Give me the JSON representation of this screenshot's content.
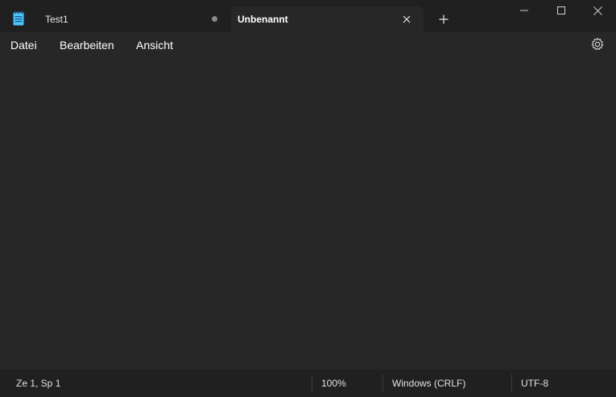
{
  "window": {
    "tabs": [
      {
        "label": "Test1",
        "active": false,
        "unsaved": true
      },
      {
        "label": "Unbenannt",
        "active": true
      }
    ],
    "icons": {
      "app": "notepad-icon",
      "close_tab": "close-icon",
      "new_tab": "plus-icon",
      "minimize": "minimize-icon",
      "maximize": "maximize-icon",
      "close_window": "close-icon",
      "settings": "gear-icon"
    }
  },
  "menubar": {
    "items": [
      "Datei",
      "Bearbeiten",
      "Ansicht"
    ]
  },
  "editor": {
    "content": ""
  },
  "statusbar": {
    "position": "Ze 1, Sp 1",
    "zoom": "100%",
    "line_ending": "Windows (CRLF)",
    "encoding": "UTF-8"
  },
  "colors": {
    "titlebar_bg": "#202020",
    "content_bg": "#272727",
    "accent_icon": "#4cc2ff"
  }
}
